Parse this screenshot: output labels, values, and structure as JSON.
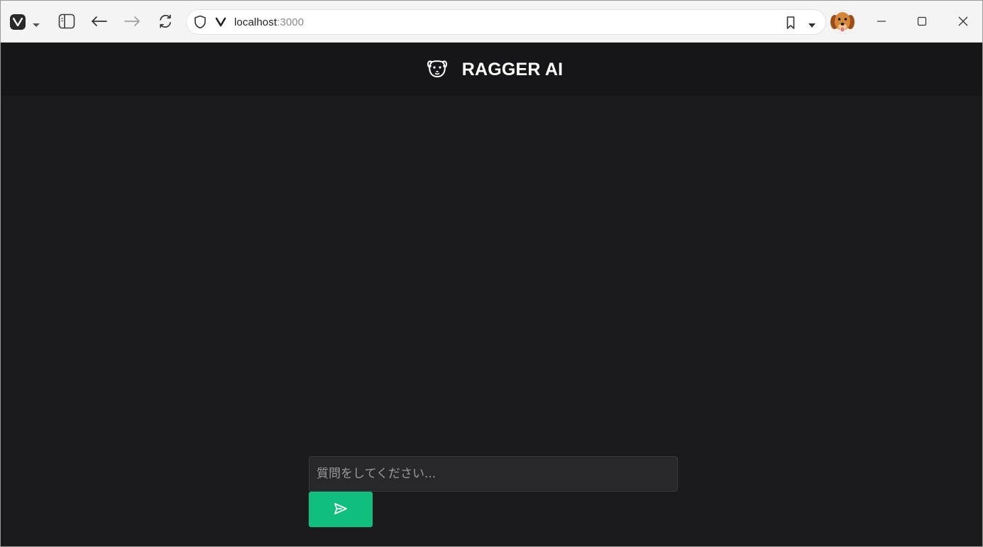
{
  "browser": {
    "url_host": "localhost",
    "url_port": ":3000",
    "icons": [
      "vivaldi-logo-icon",
      "chevron-down-icon",
      "panel-toggle-icon",
      "back-arrow-icon",
      "forward-arrow-icon",
      "reload-icon",
      "shield-icon",
      "vivaldi-v-icon",
      "bookmark-icon",
      "chevron-down-icon",
      "profile-avatar",
      "minimize-icon",
      "maximize-icon",
      "close-icon"
    ]
  },
  "app": {
    "title": "RAGGER AI",
    "logo_icon": "dog-face-icon",
    "input": {
      "placeholder": "質問をしてください...",
      "value": ""
    },
    "send_icon": "send-icon"
  },
  "colors": {
    "background": "#1b1b1d",
    "header": "#161618",
    "accent": "#10bf7e",
    "input_bg": "#28282a"
  }
}
